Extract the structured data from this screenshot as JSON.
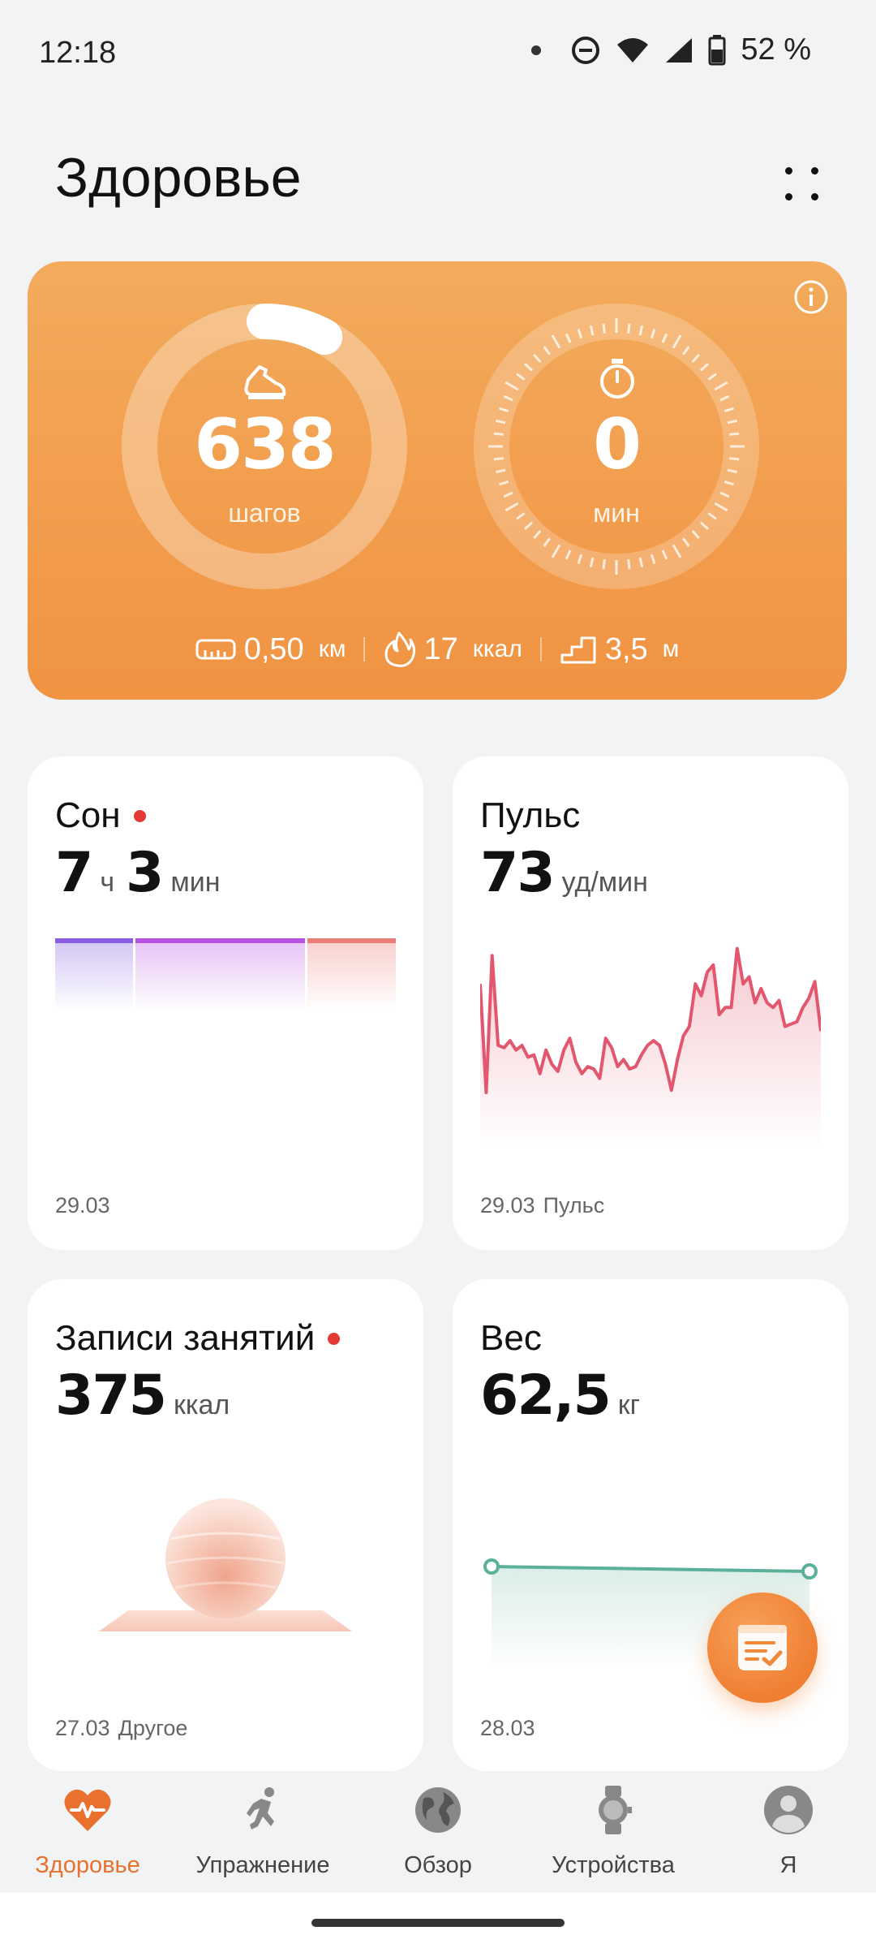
{
  "status_bar": {
    "time": "12:18",
    "battery": "52 %"
  },
  "header": {
    "title": "Здоровье"
  },
  "activity": {
    "steps": {
      "value": "638",
      "unit": "шагов",
      "progress": 0.08
    },
    "minutes": {
      "value": "0",
      "unit": "мин"
    },
    "distance": {
      "value": "0,50",
      "unit": "км"
    },
    "calories": {
      "value": "17",
      "unit": "ккал"
    },
    "floors": {
      "value": "3,5",
      "unit": "м"
    }
  },
  "cards": {
    "sleep": {
      "title": "Сон",
      "hours": "7",
      "hours_unit": "ч",
      "minutes": "3",
      "minutes_unit": "мин",
      "date": "29.03"
    },
    "pulse": {
      "title": "Пульс",
      "value": "73",
      "unit": "уд/мин",
      "date": "29.03",
      "caption": "Пульс",
      "chart_data": {
        "type": "line",
        "values": [
          130,
          84,
          142,
          104,
          103,
          106,
          102,
          104,
          99,
          100,
          92,
          102,
          96,
          93,
          102,
          107,
          97,
          92,
          95,
          94,
          90,
          107,
          103,
          95,
          98,
          94,
          95,
          100,
          104,
          106,
          104,
          96,
          85,
          98,
          108,
          112,
          130,
          125,
          135,
          138,
          117,
          120,
          120,
          145,
          130,
          133,
          122,
          128,
          122,
          120,
          123,
          112,
          113,
          114,
          120,
          124,
          131,
          110
        ]
      }
    },
    "workouts": {
      "title": "Записи занятий",
      "value": "375",
      "unit": "ккал",
      "date": "27.03",
      "caption": "Другое"
    },
    "weight": {
      "title": "Вес",
      "value": "62,5",
      "unit": "кг",
      "date": "28.03",
      "chart_data": {
        "type": "line",
        "values": [
          63.0,
          62.5
        ]
      }
    }
  },
  "nav": [
    {
      "label": "Здоровье",
      "icon": "heart-pulse-icon",
      "active": true
    },
    {
      "label": "Упражнение",
      "icon": "runner-icon",
      "active": false
    },
    {
      "label": "Обзор",
      "icon": "globe-icon",
      "active": false
    },
    {
      "label": "Устройства",
      "icon": "watch-icon",
      "active": false
    },
    {
      "label": "Я",
      "icon": "profile-icon",
      "active": false
    }
  ],
  "colors": {
    "accent": "#e8712e",
    "card_orange": "#f09342",
    "pulse": "#e2576e",
    "weight": "#5bb09a"
  }
}
